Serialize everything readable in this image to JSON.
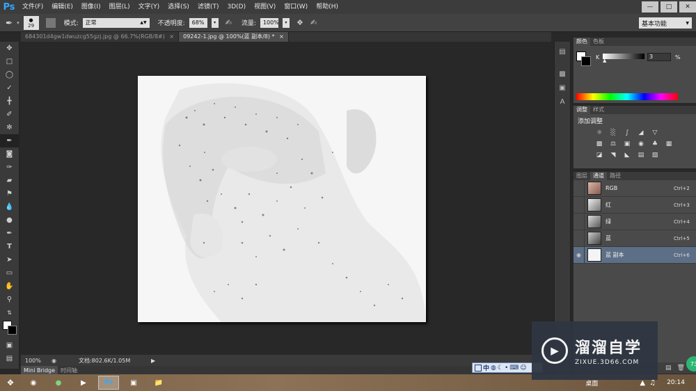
{
  "app": {
    "logo": "Ps"
  },
  "menu": [
    "文件(F)",
    "编辑(E)",
    "图像(I)",
    "图层(L)",
    "文字(Y)",
    "选择(S)",
    "滤镜(T)",
    "3D(D)",
    "视图(V)",
    "窗口(W)",
    "帮助(H)"
  ],
  "options": {
    "brush_size": "29",
    "mode_label": "模式:",
    "mode_value": "正常",
    "opacity_label": "不透明度:",
    "opacity_value": "68%",
    "flow_label": "流量:",
    "flow_value": "100%",
    "workspace": "基本功能"
  },
  "tabs": [
    {
      "label": "684301d4gw1dwuzcg55gzj.jpg @ 66.7%(RGB/8#)",
      "close": "×"
    },
    {
      "label": "09242-1.jpg @ 100%(蓝 副本/8) *",
      "close": "×"
    }
  ],
  "status": {
    "zoom": "100%",
    "doc_info": "文档:802.6K/1.05M"
  },
  "bottom_tabs": [
    "Mini Bridge",
    "时间轴"
  ],
  "color_panel": {
    "tabs": [
      "颜色",
      "色板"
    ],
    "channel_label": "K",
    "value": "3",
    "unit": "%"
  },
  "adjust_panel": {
    "tabs": [
      "调整",
      "样式"
    ],
    "title": "添加调整"
  },
  "channels_panel": {
    "tabs": [
      "图层",
      "通道",
      "路径"
    ],
    "rows": [
      {
        "name": "RGB",
        "shortcut": "Ctrl+2"
      },
      {
        "name": "红",
        "shortcut": "Ctrl+3"
      },
      {
        "name": "绿",
        "shortcut": "Ctrl+4"
      },
      {
        "name": "蓝",
        "shortcut": "Ctrl+5"
      },
      {
        "name": "蓝 副本",
        "shortcut": "Ctrl+6"
      }
    ]
  },
  "taskbar": {
    "desktop_label": "桌面",
    "time": "20:14"
  },
  "ime": {
    "lang": "中"
  },
  "watermark": {
    "title": "溜溜自学",
    "url": "ZIXUE.3D66.COM"
  },
  "badge": "73",
  "colors": {
    "accent": "#31a8ff",
    "selected_row": "#5d6f86",
    "panel": "#4a4a4a"
  }
}
